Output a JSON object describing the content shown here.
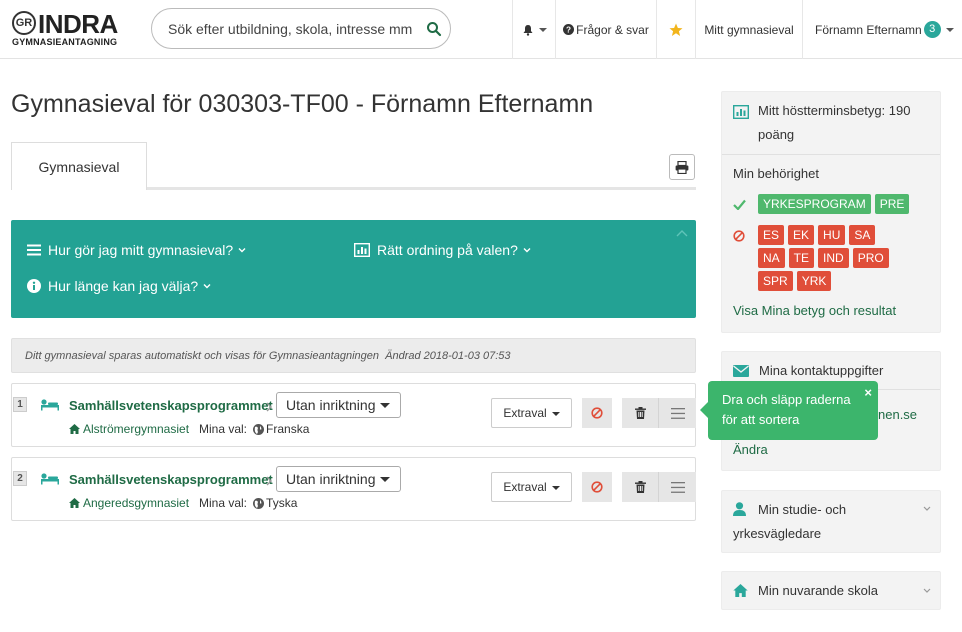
{
  "header": {
    "logo_initials": "GR",
    "logo_name": "INDRA",
    "logo_sub": "GYMNASIEANTAGNING",
    "search_placeholder": "Sök efter utbildning, skola, intresse mm",
    "faq_label": "Frågor & svar",
    "my_choice_label": "Mitt gymnasieval",
    "user_name": "Förnamn Efternamn",
    "user_badge": "3"
  },
  "page": {
    "title": "Gymnasieval för 030303-TF00 - Förnamn Efternamn",
    "tab_label": "Gymnasieval"
  },
  "help_panel": {
    "item1": "Hur gör jag mitt gymnasieval?",
    "item2": "Rätt ordning på valen?",
    "item3": "Hur länge kan jag välja?"
  },
  "info_bar": {
    "text": "Ditt gymnasieval sparas automatiskt och visas för Gymnasieantagningen",
    "changed": "Ändrad 2018-01-03 07:53"
  },
  "choices": [
    {
      "num": "1",
      "program": "Samhällsvetenskapsprogrammet",
      "orientation": "Utan inriktning",
      "school": "Alströmergymnasiet",
      "mina_label": "Mina val:",
      "language": "Franska",
      "extra_label": "Extraval"
    },
    {
      "num": "2",
      "program": "Samhällsvetenskapsprogrammet",
      "orientation": "Utan inriktning",
      "school": "Angeredsgymnasiet",
      "mina_label": "Mina val:",
      "language": "Tyska",
      "extra_label": "Extraval"
    }
  ],
  "tooltip": {
    "text": "Dra och släpp raderna för att sortera",
    "close": "×"
  },
  "sidebar": {
    "grades_title": "Mitt höstterminsbetyg: 190 poäng",
    "eligibility_title": "Min behörighet",
    "eligible": [
      "YRKESPROGRAM",
      "PRE"
    ],
    "not_eligible": [
      "ES",
      "EK",
      "HU",
      "SA",
      "NA",
      "TE",
      "IND",
      "PRO",
      "SPR",
      "YRK"
    ],
    "grades_link": "Visa Mina betyg och resultat",
    "contact_title": "Mina kontaktuppgifter",
    "contact_email_partial": "nen.se",
    "contact_edit": "Ändra",
    "counselor_title": "Min studie- och yrkesvägledare",
    "school_title": "Min nuvarande skola"
  },
  "colors": {
    "teal": "#23a294",
    "green_text": "#1f6b45",
    "eligible": "#4fb86d",
    "not_eligible": "#e04e39",
    "tooltip": "#3cb56c"
  }
}
